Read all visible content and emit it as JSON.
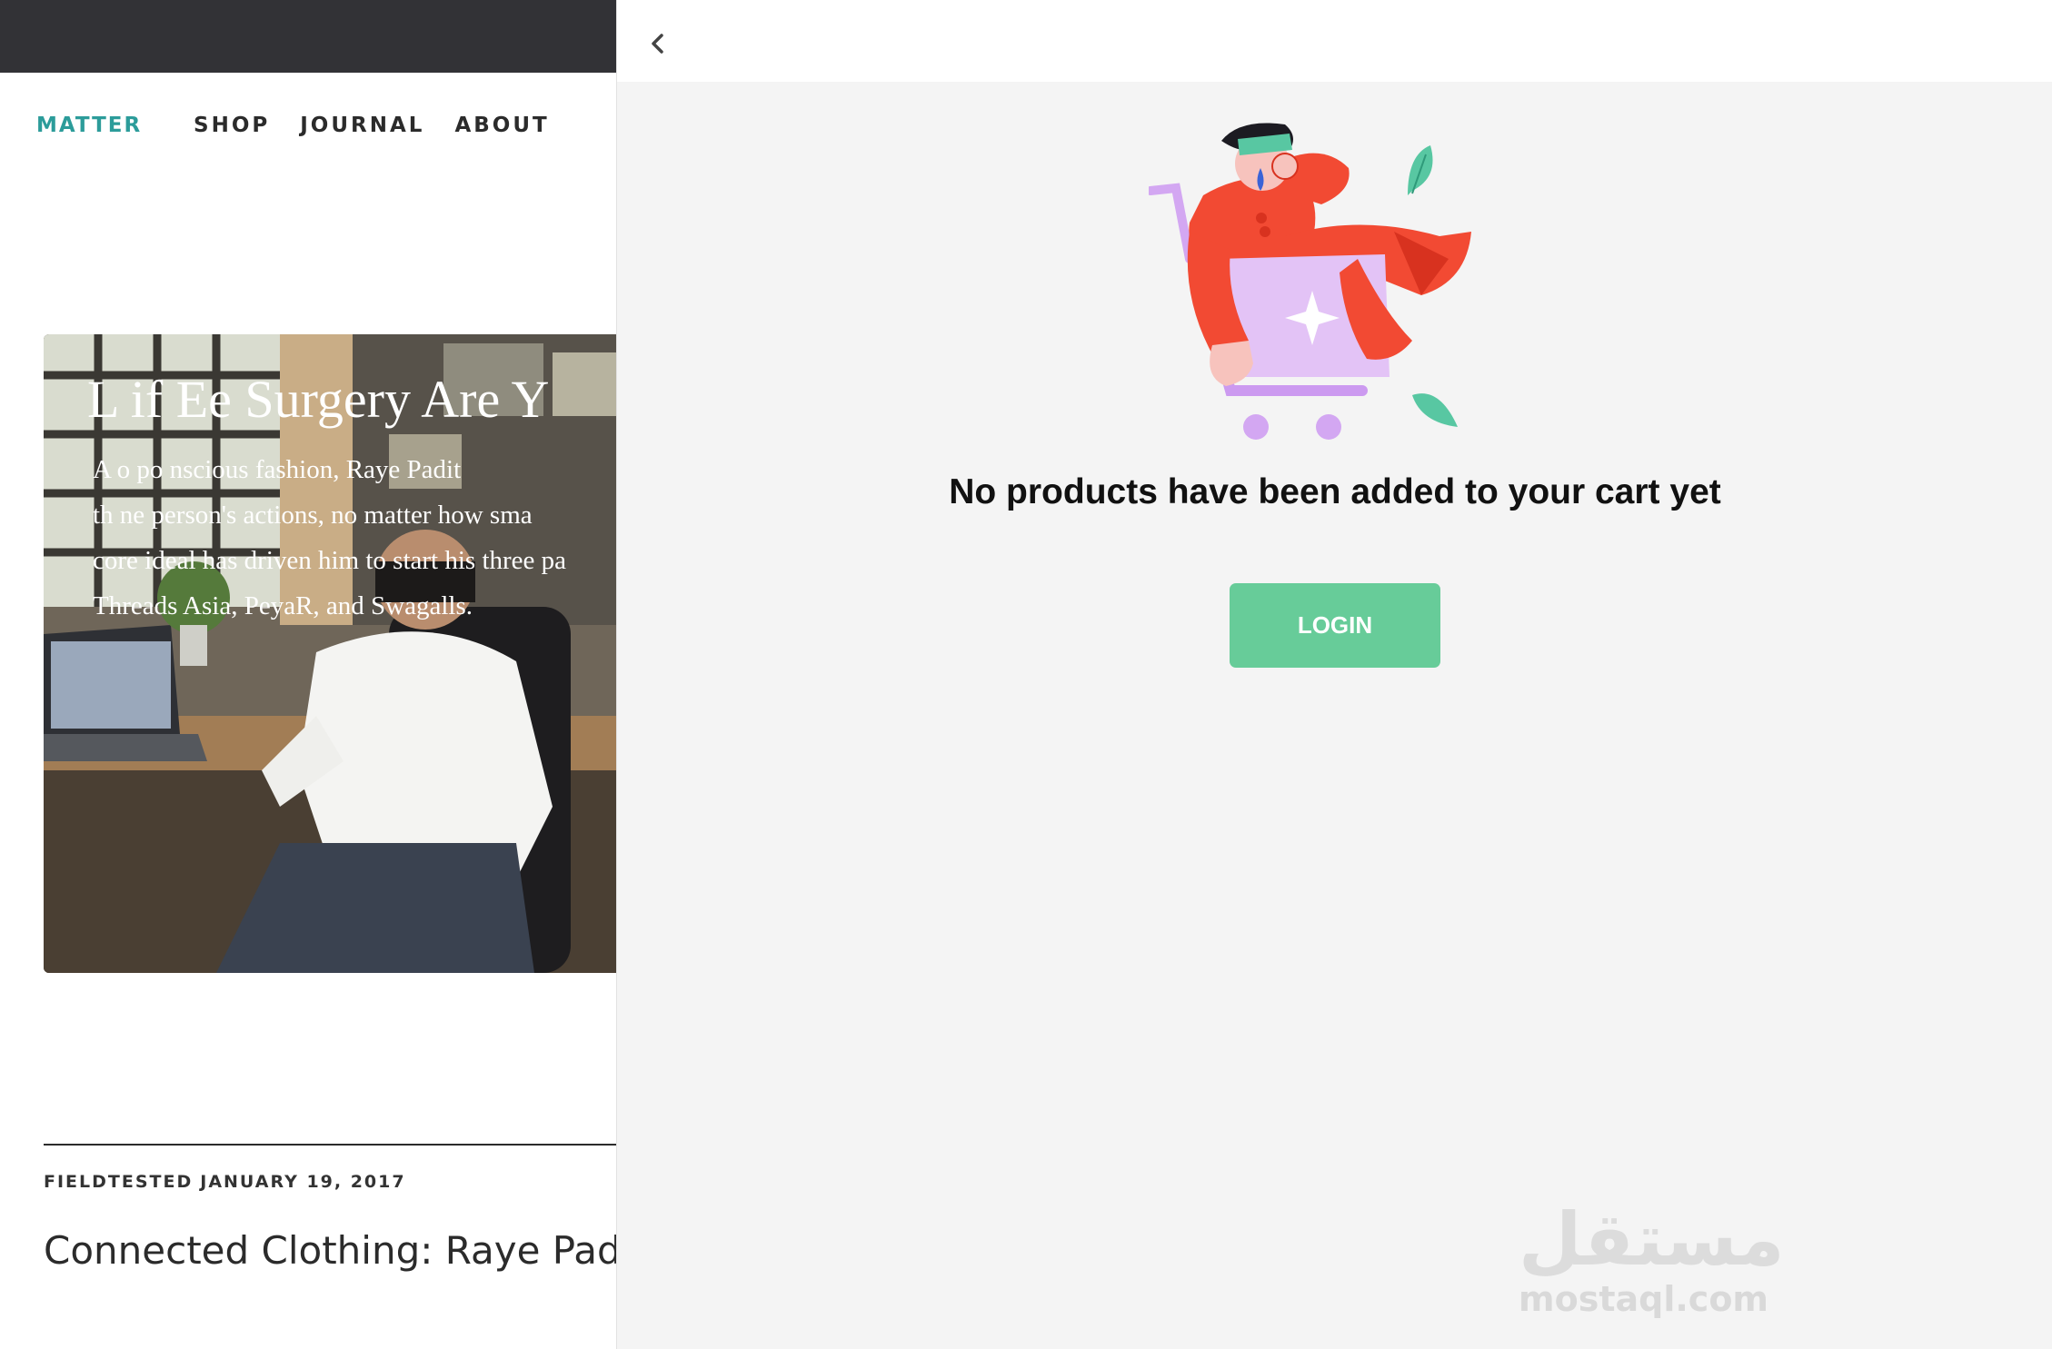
{
  "site": {
    "brand": "MATTER",
    "nav": [
      "SHOP",
      "JOURNAL",
      "ABOUT"
    ]
  },
  "hero": {
    "title": "L  if  Ee Surgery Are Y",
    "excerpt": "A   o   po  nscious fashion, Raye Padit\nth  ne person's actions, no matter how sma\ncore ideal has driven him to start his three pa\nThreads Asia, PeyaR, and Swagalls."
  },
  "article": {
    "category": "FIELDTESTED",
    "date": "JANUARY 19, 2017",
    "title": "Connected Clothing: Raye Padit"
  },
  "cart": {
    "back_icon": "chevron-left-icon",
    "empty_message": "No products have been added to your cart yet",
    "login_label": "LOGIN",
    "colors": {
      "login": "#67cc99",
      "brand": "#2c9c9a",
      "panel": "#f4f4f4"
    }
  },
  "watermark": {
    "arabic": "مستقل",
    "latin": "mostaql.com"
  }
}
